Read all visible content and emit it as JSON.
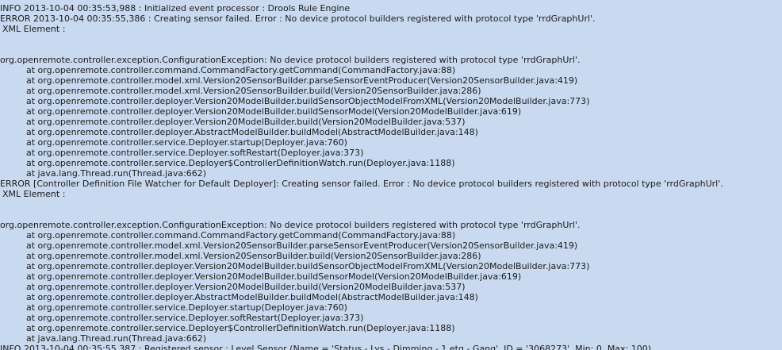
{
  "log_lines": [
    {
      "kind": "plain",
      "text": "INFO 2013-10-04 00:35:53,988 : Initialized event processor : Drools Rule Engine"
    },
    {
      "kind": "plain",
      "text": "ERROR 2013-10-04 00:35:55,386 : Creating sensor failed. Error : No device protocol builders registered with protocol type 'rrdGraphUrl'."
    },
    {
      "kind": "xml",
      "text": "XML Element :"
    },
    {
      "kind": "blank",
      "text": ""
    },
    {
      "kind": "blank",
      "text": ""
    },
    {
      "kind": "plain",
      "text": "org.openremote.controller.exception.ConfigurationException: No device protocol builders registered with protocol type 'rrdGraphUrl'."
    },
    {
      "kind": "stack",
      "text": "at org.openremote.controller.command.CommandFactory.getCommand(CommandFactory.java:88)"
    },
    {
      "kind": "stack",
      "text": "at org.openremote.controller.model.xml.Version20SensorBuilder.parseSensorEventProducer(Version20SensorBuilder.java:419)"
    },
    {
      "kind": "stack",
      "text": "at org.openremote.controller.model.xml.Version20SensorBuilder.build(Version20SensorBuilder.java:286)"
    },
    {
      "kind": "stack",
      "text": "at org.openremote.controller.deployer.Version20ModelBuilder.buildSensorObjectModelFromXML(Version20ModelBuilder.java:773)"
    },
    {
      "kind": "stack",
      "text": "at org.openremote.controller.deployer.Version20ModelBuilder.buildSensorModel(Version20ModelBuilder.java:619)"
    },
    {
      "kind": "stack",
      "text": "at org.openremote.controller.deployer.Version20ModelBuilder.build(Version20ModelBuilder.java:537)"
    },
    {
      "kind": "stack",
      "text": "at org.openremote.controller.deployer.AbstractModelBuilder.buildModel(AbstractModelBuilder.java:148)"
    },
    {
      "kind": "stack",
      "text": "at org.openremote.controller.service.Deployer.startup(Deployer.java:760)"
    },
    {
      "kind": "stack",
      "text": "at org.openremote.controller.service.Deployer.softRestart(Deployer.java:373)"
    },
    {
      "kind": "stack",
      "text": "at org.openremote.controller.service.Deployer$ControllerDefinitionWatch.run(Deployer.java:1188)"
    },
    {
      "kind": "stack",
      "text": "at java.lang.Thread.run(Thread.java:662)"
    },
    {
      "kind": "plain",
      "text": "ERROR [Controller Definition File Watcher for Default Deployer]: Creating sensor failed. Error : No device protocol builders registered with protocol type 'rrdGraphUrl'."
    },
    {
      "kind": "xml",
      "text": "XML Element :"
    },
    {
      "kind": "blank",
      "text": ""
    },
    {
      "kind": "blank",
      "text": ""
    },
    {
      "kind": "plain",
      "text": "org.openremote.controller.exception.ConfigurationException: No device protocol builders registered with protocol type 'rrdGraphUrl'."
    },
    {
      "kind": "stack",
      "text": "at org.openremote.controller.command.CommandFactory.getCommand(CommandFactory.java:88)"
    },
    {
      "kind": "stack",
      "text": "at org.openremote.controller.model.xml.Version20SensorBuilder.parseSensorEventProducer(Version20SensorBuilder.java:419)"
    },
    {
      "kind": "stack",
      "text": "at org.openremote.controller.model.xml.Version20SensorBuilder.build(Version20SensorBuilder.java:286)"
    },
    {
      "kind": "stack",
      "text": "at org.openremote.controller.deployer.Version20ModelBuilder.buildSensorObjectModelFromXML(Version20ModelBuilder.java:773)"
    },
    {
      "kind": "stack",
      "text": "at org.openremote.controller.deployer.Version20ModelBuilder.buildSensorModel(Version20ModelBuilder.java:619)"
    },
    {
      "kind": "stack",
      "text": "at org.openremote.controller.deployer.Version20ModelBuilder.build(Version20ModelBuilder.java:537)"
    },
    {
      "kind": "stack",
      "text": "at org.openremote.controller.deployer.AbstractModelBuilder.buildModel(AbstractModelBuilder.java:148)"
    },
    {
      "kind": "stack",
      "text": "at org.openremote.controller.service.Deployer.startup(Deployer.java:760)"
    },
    {
      "kind": "stack",
      "text": "at org.openremote.controller.service.Deployer.softRestart(Deployer.java:373)"
    },
    {
      "kind": "stack",
      "text": "at org.openremote.controller.service.Deployer$ControllerDefinitionWatch.run(Deployer.java:1188)"
    },
    {
      "kind": "stack",
      "text": "at java.lang.Thread.run(Thread.java:662)"
    },
    {
      "kind": "plain",
      "text": "INFO 2013-10-04 00:35:55,387 : Registered sensor : Level Sensor (Name = 'Status - Lys - Dimming - 1 etg - Gang', ID = '3068273', Min: 0, Max: 100)"
    }
  ]
}
